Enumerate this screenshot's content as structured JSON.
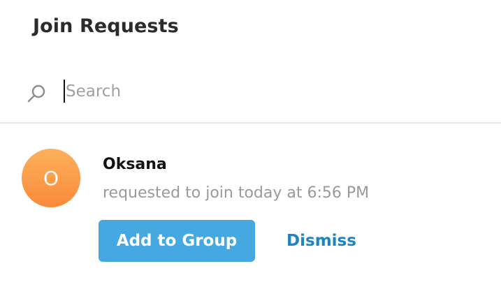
{
  "header": {
    "title": "Join Requests"
  },
  "search": {
    "placeholder": "Search",
    "value": "",
    "icon": "search-icon"
  },
  "requests": [
    {
      "avatar_initial": "O",
      "name": "Oksana",
      "status": "requested to join today at 6:56 PM",
      "add_label": "Add to Group",
      "dismiss_label": "Dismiss"
    }
  ],
  "colors": {
    "accent": "#45a8e1",
    "link": "#1d84c4",
    "avatar_top": "#fdb15c",
    "avatar_bottom": "#f98a3a"
  }
}
